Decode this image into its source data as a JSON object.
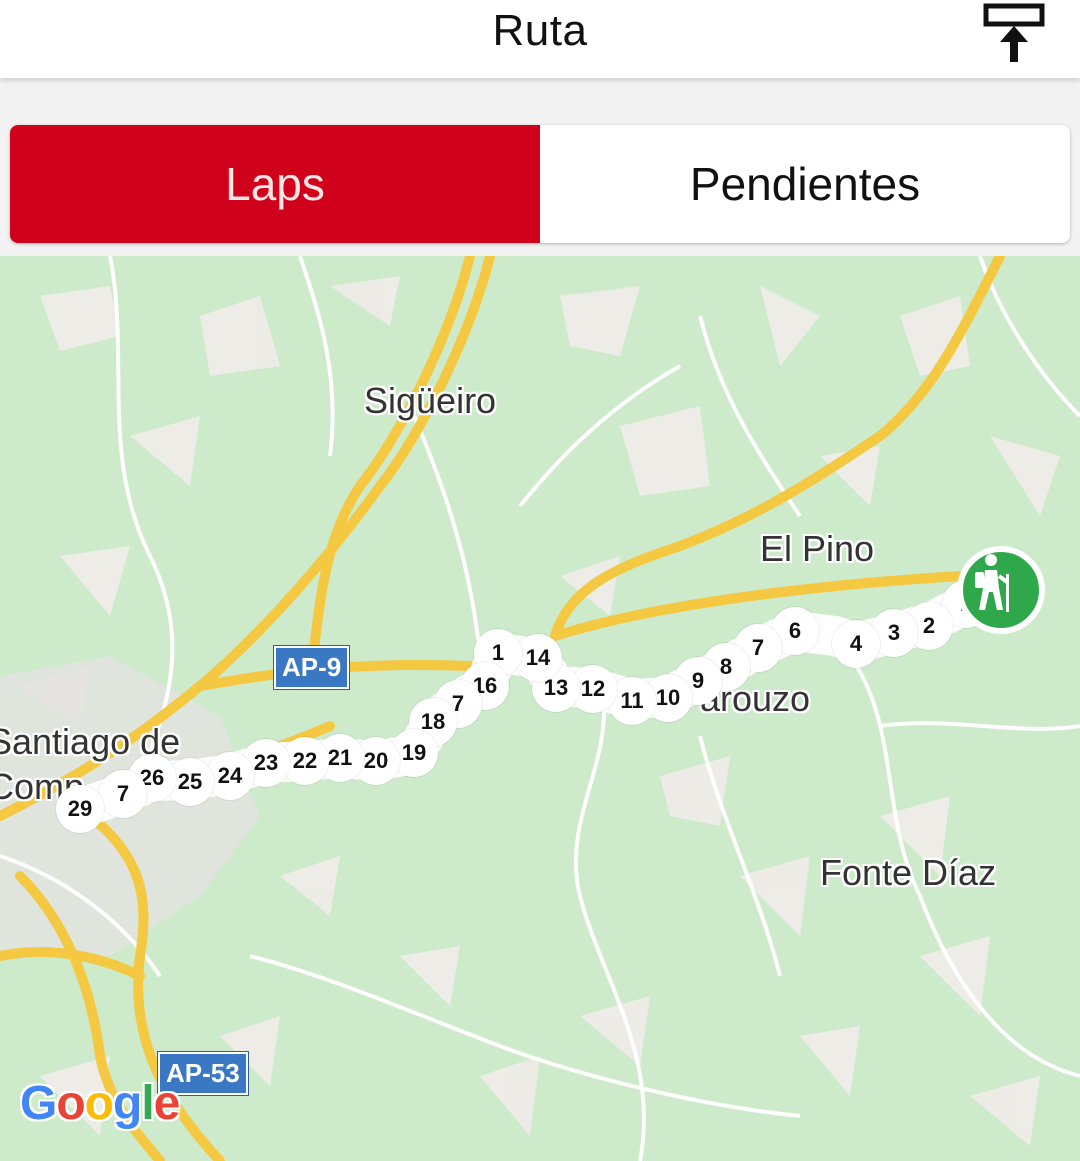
{
  "header": {
    "title": "Ruta",
    "export_icon": "export-upload-icon"
  },
  "tabs": [
    {
      "label": "Laps",
      "active": true
    },
    {
      "label": "Pendientes",
      "active": false
    }
  ],
  "map": {
    "places": {
      "sigueiro": "Sigüeiro",
      "el_pino": "El Pino",
      "arouzo": "arouzo",
      "santiago_1": "Santiago de",
      "santiago_2": "Comp",
      "fonte_diaz": "Fonte Díaz"
    },
    "roads": {
      "ap9": "AP-9",
      "ap53": "AP-53"
    },
    "laps": [
      "1",
      "2",
      "3",
      "4",
      "6",
      "7",
      "8",
      "9",
      "10",
      "11",
      "12",
      "13",
      "14",
      "1",
      "16",
      "7",
      "18",
      "19",
      "20",
      "21",
      "22",
      "23",
      "24",
      "25",
      "26",
      "7",
      "29"
    ],
    "start_marker_icon": "hiker-icon",
    "attribution": "Google",
    "colors": {
      "route": "#ffffff",
      "accent": "#d0021b",
      "start": "#2ea84a"
    }
  }
}
